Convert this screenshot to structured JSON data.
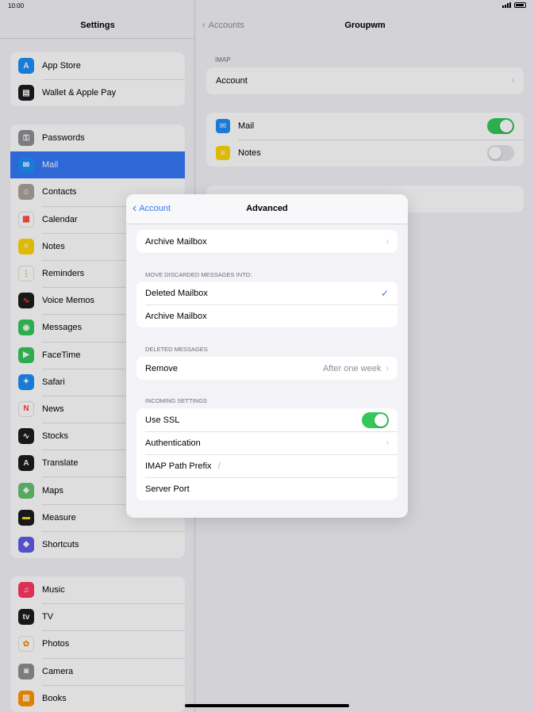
{
  "status": {
    "time": "10:00"
  },
  "sidebar": {
    "title": "Settings",
    "groups": [
      [
        {
          "label": "App Store",
          "icon": "app-store-icon",
          "color": "#1c8ef9",
          "glyph": "A"
        },
        {
          "label": "Wallet & Apple Pay",
          "icon": "wallet-icon",
          "color": "#1c1c1e",
          "glyph": "▤"
        }
      ],
      [
        {
          "label": "Passwords",
          "icon": "key-icon",
          "color": "#8e8e93",
          "glyph": "⚿"
        },
        {
          "label": "Mail",
          "icon": "mail-icon",
          "color": "#1c8ef9",
          "glyph": "✉",
          "selected": true
        },
        {
          "label": "Contacts",
          "icon": "contacts-icon",
          "color": "#a8a39c",
          "glyph": "☺"
        },
        {
          "label": "Calendar",
          "icon": "calendar-icon",
          "color": "#ffffff",
          "glyph": "▦",
          "fg": "#ff3b30"
        },
        {
          "label": "Notes",
          "icon": "notes-icon",
          "color": "#ffd60a",
          "glyph": "≡"
        },
        {
          "label": "Reminders",
          "icon": "reminders-icon",
          "color": "#ffffff",
          "glyph": "⋮",
          "fg": "#ff9500"
        },
        {
          "label": "Voice Memos",
          "icon": "voice-memos-icon",
          "color": "#1c1c1e",
          "glyph": "∿",
          "fg": "#ff3b30"
        },
        {
          "label": "Messages",
          "icon": "messages-icon",
          "color": "#34c759",
          "glyph": "◉"
        },
        {
          "label": "FaceTime",
          "icon": "facetime-icon",
          "color": "#34c759",
          "glyph": "▶"
        },
        {
          "label": "Safari",
          "icon": "safari-icon",
          "color": "#1c8ef9",
          "glyph": "✦"
        },
        {
          "label": "News",
          "icon": "news-icon",
          "color": "#ffffff",
          "glyph": "N",
          "fg": "#ff3b30"
        },
        {
          "label": "Stocks",
          "icon": "stocks-icon",
          "color": "#1c1c1e",
          "glyph": "∿"
        },
        {
          "label": "Translate",
          "icon": "translate-icon",
          "color": "#1c1c1e",
          "glyph": "A"
        },
        {
          "label": "Maps",
          "icon": "maps-icon",
          "color": "#62c370",
          "glyph": "◈"
        },
        {
          "label": "Measure",
          "icon": "measure-icon",
          "color": "#1c1c1e",
          "glyph": "▬",
          "fg": "#ffd60a"
        },
        {
          "label": "Shortcuts",
          "icon": "shortcuts-icon",
          "color": "#5e5ce6",
          "glyph": "◆"
        }
      ],
      [
        {
          "label": "Music",
          "icon": "music-icon",
          "color": "#ff375f",
          "glyph": "♫"
        },
        {
          "label": "TV",
          "icon": "tv-icon",
          "color": "#1c1c1e",
          "glyph": "tv"
        },
        {
          "label": "Photos",
          "icon": "photos-icon",
          "color": "#ffffff",
          "glyph": "✿",
          "fg": "#ff9500"
        },
        {
          "label": "Camera",
          "icon": "camera-icon",
          "color": "#8e8e93",
          "glyph": "◙"
        },
        {
          "label": "Books",
          "icon": "books-icon",
          "color": "#ff9500",
          "glyph": "▥"
        }
      ]
    ]
  },
  "detail": {
    "back_label": "Accounts",
    "title": "Groupwm",
    "imap_header": "IMAP",
    "account_label": "Account",
    "mail_label": "Mail",
    "notes_label": "Notes"
  },
  "modal": {
    "back_label": "Account",
    "title": "Advanced",
    "archive_row": "Archive Mailbox",
    "discard_header": "Move discarded messages into:",
    "discard_options": [
      "Deleted Mailbox",
      "Archive Mailbox"
    ],
    "deleted_header": "Deleted Messages",
    "remove_label": "Remove",
    "remove_value": "After one week",
    "incoming_header": "Incoming Settings",
    "use_ssl_label": "Use SSL",
    "authentication_label": "Authentication",
    "imap_prefix_label": "IMAP Path Prefix",
    "imap_prefix_value": "/",
    "server_port_label": "Server Port"
  }
}
